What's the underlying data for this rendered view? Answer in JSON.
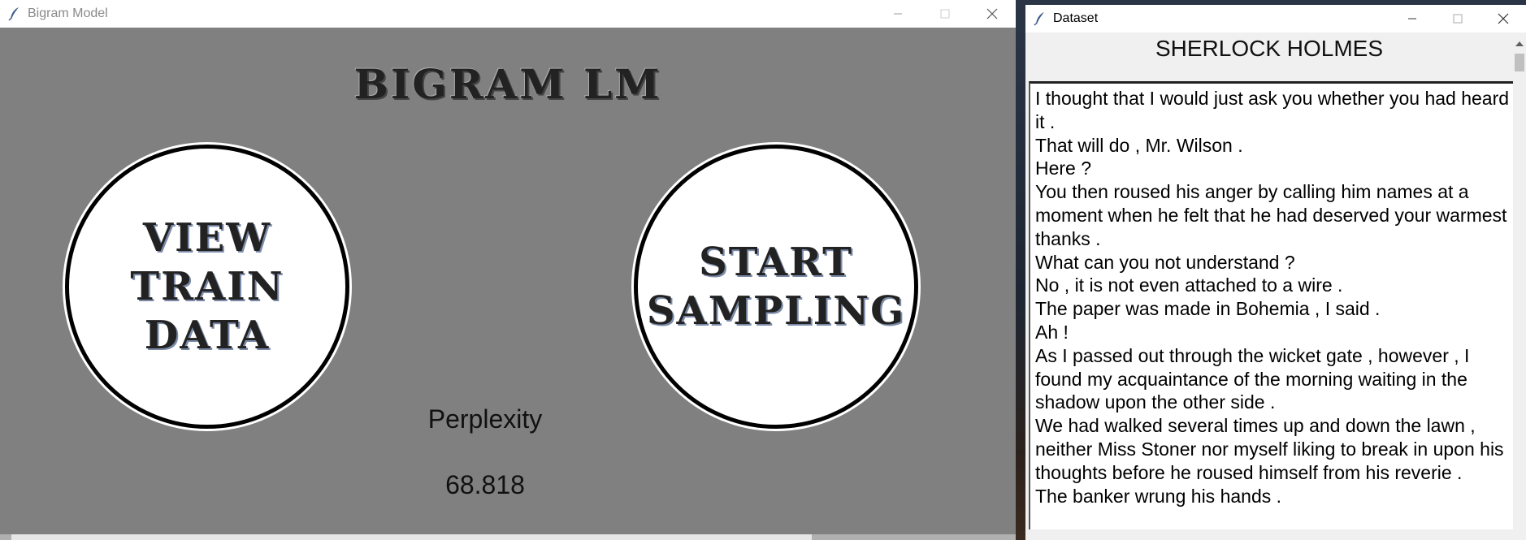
{
  "windows": {
    "bigram": {
      "title": "Bigram Model",
      "app_title": "BIGRAM LM",
      "view_button": {
        "line1": "VIEW",
        "line2": "TRAIN DATA"
      },
      "start_button": {
        "line1": "START",
        "line2": "SAMPLING"
      },
      "perplexity_label": "Perplexity",
      "perplexity_value": "68.818"
    },
    "dataset": {
      "title": "Dataset",
      "heading": "SHERLOCK HOLMES",
      "lines": [
        "I thought that I would just ask you whether you had heard it .",
        "That will do , Mr. Wilson .",
        "Here ?",
        "You then roused his anger by calling him names at a moment when he felt that he had deserved your warmest thanks .",
        "What can you not understand ?",
        "No , it is not even attached to a wire .",
        "The paper was made in Bohemia , I said .",
        "Ah !",
        "As I passed out through the wicket gate , however , I found my acquaintance of the morning waiting in the shadow upon the other side .",
        "We had walked several times up and down the lawn , neither Miss Stoner nor myself liking to break in upon his thoughts before he roused himself from his reverie .",
        "The banker wrung his hands ."
      ]
    }
  },
  "icons": {
    "app_icon": "feather-icon",
    "minimize": "minimize-icon",
    "maximize": "maximize-icon",
    "close": "close-icon"
  },
  "colors": {
    "bigram_background": "#808080",
    "button_fill": "#ffffff",
    "button_border": "#000000"
  }
}
